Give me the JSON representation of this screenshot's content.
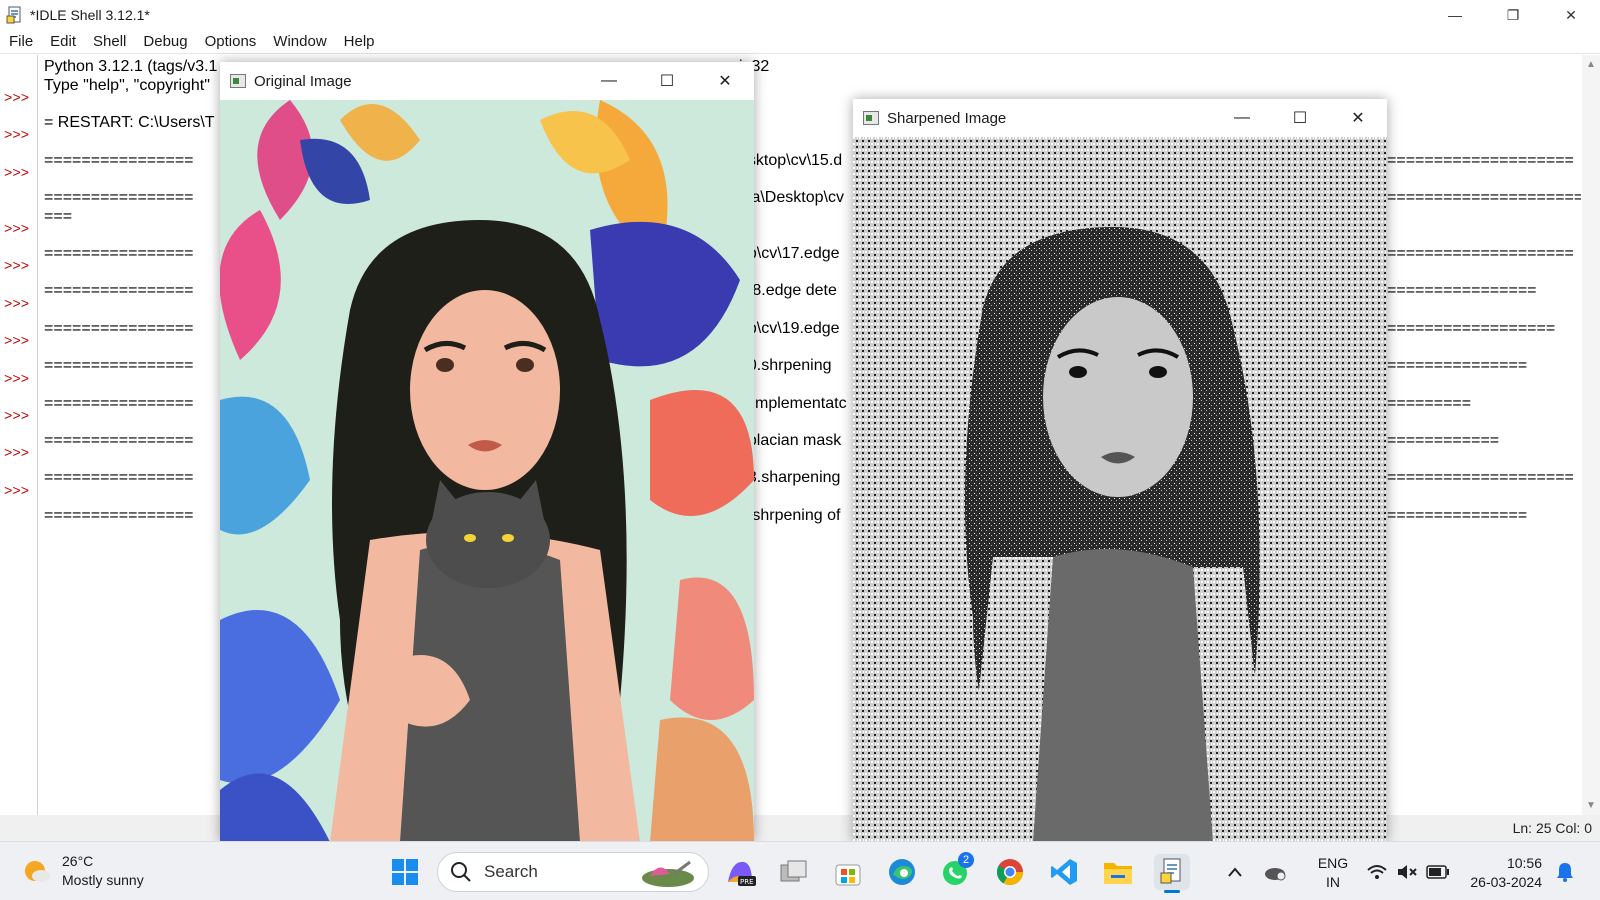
{
  "window": {
    "title": "*IDLE Shell 3.12.1*",
    "controls": {
      "minimize": "—",
      "restore": "❐",
      "close": "✕"
    }
  },
  "menu": [
    "File",
    "Edit",
    "Shell",
    "Debug",
    "Options",
    "Window",
    "Help"
  ],
  "shell": {
    "prompt": ">>>",
    "lines_left": [
      "Python 3.12.1 (tags/v3.1",
      "Type \"help\", \"copyright\"",
      "",
      "= RESTART: C:\\Users\\T",
      "",
      "================",
      "",
      "================",
      "===",
      "",
      "================",
      "",
      "================",
      "",
      "================",
      "",
      "================",
      "",
      "================",
      "",
      "================",
      "",
      "================",
      "",
      "================"
    ],
    "lines_mid": [
      {
        "text": "in32",
        "row": 0
      },
      {
        "text": "esktop\\cv\\15.d",
        "row": 5
      },
      {
        "text": "eja\\Desktop\\cv",
        "row": 7
      },
      {
        "text": "op\\cv\\17.edge",
        "row": 10
      },
      {
        "text": "\\18.edge dete",
        "row": 12
      },
      {
        "text": "op\\cv\\19.edge",
        "row": 14
      },
      {
        "text": "20.shrpening",
        "row": 16
      },
      {
        "text": "k implementatc",
        "row": 18
      },
      {
        "text": "aplacian mask",
        "row": 20
      },
      {
        "text": "23.sharpening",
        "row": 22
      },
      {
        "text": "4.shrpening of",
        "row": 24
      }
    ],
    "lines_right": [
      {
        "text": "====================",
        "row": 5
      },
      {
        "text": "=========================",
        "row": 7
      },
      {
        "text": "====================",
        "row": 10
      },
      {
        "text": "================",
        "row": 12
      },
      {
        "text": "==================",
        "row": 14
      },
      {
        "text": "===============",
        "row": 16
      },
      {
        "text": "=========",
        "row": 18
      },
      {
        "text": "============",
        "row": 20
      },
      {
        "text": "====================",
        "row": 22
      },
      {
        "text": "===============",
        "row": 24
      }
    ],
    "prompt_rows": [
      2,
      4,
      6,
      9,
      11,
      13,
      15,
      17,
      19,
      21,
      23
    ]
  },
  "status": {
    "position": "Ln: 25  Col: 0"
  },
  "cv_windows": {
    "original": {
      "title": "Original Image"
    },
    "sharpened": {
      "title": "Sharpened Image"
    }
  },
  "taskbar": {
    "weather_temp": "26°C",
    "weather_desc": "Mostly sunny",
    "search_label": "Search",
    "whatsapp_badge": "2",
    "lang_top": "ENG",
    "lang_bottom": "IN",
    "time": "10:56",
    "date": "26-03-2024"
  },
  "colors": {
    "prompt": "#c00000",
    "taskbar_bg": "#eef0f4",
    "accent": "#0078d4"
  }
}
